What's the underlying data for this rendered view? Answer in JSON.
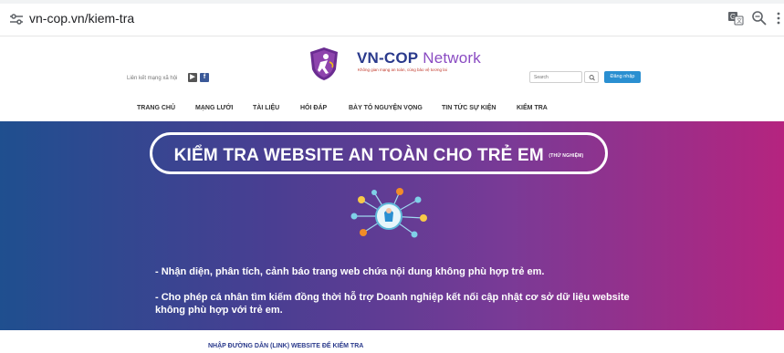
{
  "browser": {
    "url": "vn-cop.vn/kiem-tra",
    "icons": [
      "tune-icon",
      "translate-icon",
      "zoom-icon",
      "more-icon"
    ]
  },
  "header": {
    "social_label": "Liên kết mạng xã hội",
    "social_icons": [
      "youtube-icon",
      "facebook-icon"
    ],
    "facebook_glyph": "f",
    "brand_name": "VN-COP",
    "brand_suffix": " Network",
    "tagline": "Không gian mạng an toàn, cùng bảo vệ tương lai",
    "search_placeholder": "Search",
    "login_label": "Đăng nhập"
  },
  "nav": {
    "items": [
      "TRANG CHỦ",
      "MẠNG LƯỚI",
      "TÀI LIỆU",
      "HỎI ĐÁP",
      "BÀY TỎ NGUYỆN VỌNG",
      "TIN TỨC SỰ KIỆN",
      "KIỂM TRA"
    ]
  },
  "hero": {
    "title": "KIỂM TRA WEBSITE AN TOÀN CHO TRẺ EM",
    "title_note": "(THỬ NGHIỆM)",
    "bullets": [
      "-  Nhận diện, phân tích, cảnh báo trang web chứa nội dung không phù hợp trẻ em.",
      "-  Cho phép cá nhân tìm kiếm đồng thời hỗ trợ Doanh nghiệp kết nối cập nhật cơ sở dữ liệu website không phù hợp với trẻ em."
    ]
  },
  "check_label": "NHẬP ĐƯỜNG DẪN (LINK) WEBSITE ĐỂ KIỂM TRA",
  "colors": {
    "brand_blue": "#2a3a8c",
    "accent_purple": "#8a4bc2",
    "login_blue": "#2a8fd1",
    "gradient_left": "#1f4f8f",
    "gradient_right": "#b5247f"
  }
}
